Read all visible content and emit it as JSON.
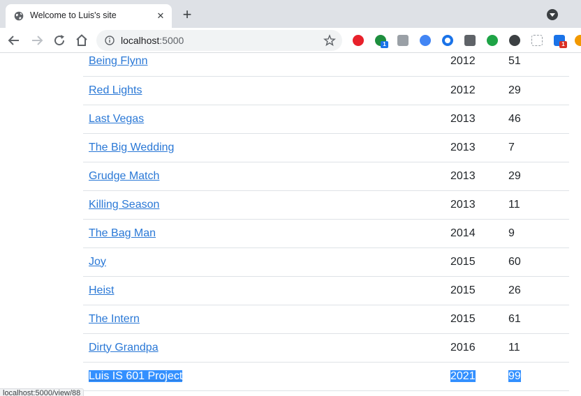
{
  "browser": {
    "tab_title": "Welcome to Luis's site",
    "tab_close": "✕",
    "new_tab": "+",
    "url_host": "localhost",
    "url_port": ":5000",
    "status_url": "localhost:5000/view/88",
    "extensions": [
      {
        "name": "adblock-plus-icon",
        "color": "#e8212b",
        "badge": null
      },
      {
        "name": "green-dot-extension-icon",
        "color": "#1e8e3e",
        "badge": "1",
        "badge_color": "#1a73e8"
      },
      {
        "name": "grey-extension-icon",
        "color": "#9aa0a6",
        "badge": null
      },
      {
        "name": "google-drive-icon",
        "color": "#4285f4",
        "badge": null
      },
      {
        "name": "blue-ring-extension-icon",
        "color": "#1a73e8",
        "badge": null
      },
      {
        "name": "dark-square-extension-icon",
        "color": "#5f6368",
        "badge": null
      },
      {
        "name": "green-face-extension-icon",
        "color": "#1ea446",
        "badge": null
      },
      {
        "name": "incognito-extension-icon",
        "color": "#3c4043",
        "badge": null
      },
      {
        "name": "dashed-square-extension-icon",
        "color": "#9aa0a6",
        "badge": null
      },
      {
        "name": "profile-extension-icon",
        "color": "#1a73e8",
        "badge": "1",
        "badge_color": "#d93025"
      },
      {
        "name": "orange-extension-icon",
        "color": "#f29900",
        "badge": null
      }
    ]
  },
  "movies": [
    {
      "title": "Being Flynn",
      "year": "2012",
      "score": "51"
    },
    {
      "title": "Red Lights",
      "year": "2012",
      "score": "29"
    },
    {
      "title": "Last Vegas",
      "year": "2013",
      "score": "46"
    },
    {
      "title": "The Big Wedding",
      "year": "2013",
      "score": "7"
    },
    {
      "title": "Grudge Match",
      "year": "2013",
      "score": "29"
    },
    {
      "title": "Killing Season",
      "year": "2013",
      "score": "11"
    },
    {
      "title": "The Bag Man",
      "year": "2014",
      "score": "9"
    },
    {
      "title": "Joy",
      "year": "2015",
      "score": "60"
    },
    {
      "title": "Heist",
      "year": "2015",
      "score": "26"
    },
    {
      "title": "The Intern",
      "year": "2015",
      "score": "61"
    },
    {
      "title": "Dirty Grandpa",
      "year": "2016",
      "score": "11"
    },
    {
      "title": "Luis IS 601 Project",
      "year": "2021",
      "score": "99",
      "selected": true
    }
  ],
  "colors": {
    "link": "#2a78d6",
    "selection": "#3390ff",
    "row_border": "#dee2e6"
  }
}
